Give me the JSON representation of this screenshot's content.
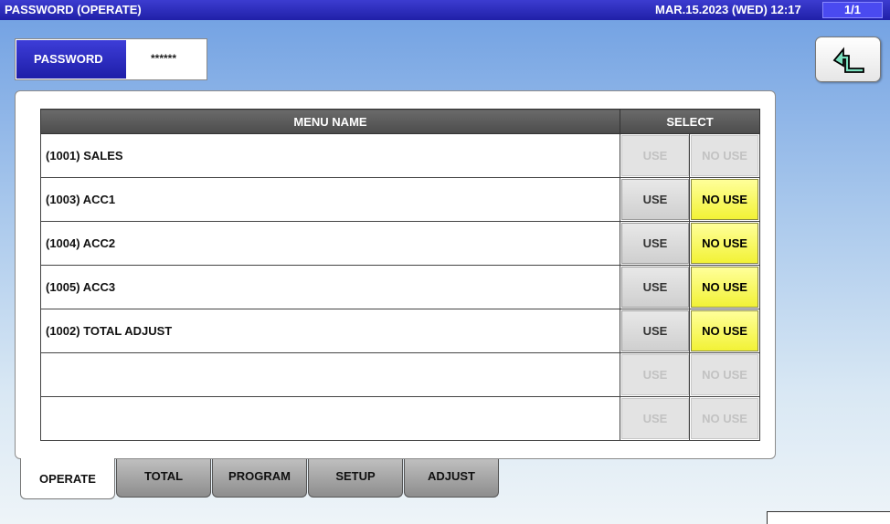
{
  "titlebar": {
    "title": "PASSWORD (OPERATE)",
    "datetime": "MAR.15.2023 (WED)  12:17",
    "page": "1/1"
  },
  "password": {
    "label": "PASSWORD",
    "value": "******"
  },
  "back_button": {
    "icon": "return-arrow-icon"
  },
  "table": {
    "headers": {
      "menu_name": "MENU NAME",
      "select": "SELECT"
    },
    "use_label": "USE",
    "no_use_label": "NO USE",
    "rows": [
      {
        "name": "(1001) SALES",
        "state": "disabled"
      },
      {
        "name": "(1003) ACC1",
        "state": "no_use"
      },
      {
        "name": "(1004) ACC2",
        "state": "no_use"
      },
      {
        "name": "(1005) ACC3",
        "state": "no_use"
      },
      {
        "name": "(1002) TOTAL ADJUST",
        "state": "no_use"
      },
      {
        "name": "",
        "state": "disabled"
      },
      {
        "name": "",
        "state": "disabled"
      }
    ]
  },
  "tabs": [
    {
      "label": "OPERATE",
      "active": true
    },
    {
      "label": "TOTAL",
      "active": false
    },
    {
      "label": "PROGRAM",
      "active": false
    },
    {
      "label": "SETUP",
      "active": false
    },
    {
      "label": "ADJUST",
      "active": false
    }
  ],
  "colors": {
    "titlebar": "#2020a8",
    "selected": "#f2f236",
    "header": "#4c4c4c"
  }
}
